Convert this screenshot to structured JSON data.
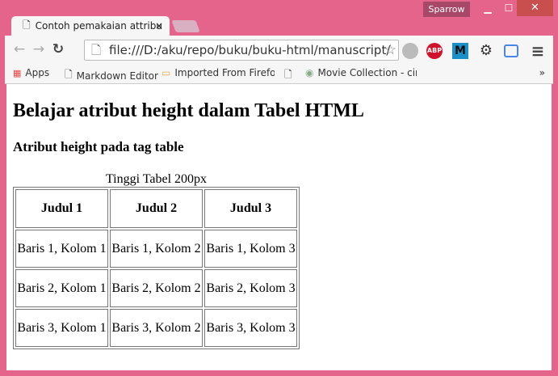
{
  "window": {
    "profile": "Sparrow",
    "minimize": "▁",
    "maximize": "☐",
    "close": "✕"
  },
  "tab": {
    "title": "Contoh pemakaian attribu",
    "close": "×"
  },
  "toolbar": {
    "back": "←",
    "forward": "→",
    "reload": "↻",
    "url": "file:///D:/aku/repo/buku/buku-html/manuscript/",
    "star": "☆",
    "abp": "ABP",
    "m": "M",
    "gear": "⚙",
    "menu": "≡"
  },
  "bookmarks": [
    {
      "label": "Apps"
    },
    {
      "label": "Markdown Editor"
    },
    {
      "label": "Imported From Firefox"
    },
    {
      "label": ""
    },
    {
      "label": "Movie Collection - cin"
    }
  ],
  "bookmarks_more": "»",
  "page": {
    "h1": "Belajar atribut height dalam Tabel HTML",
    "h3": "Atribut height pada tag table",
    "table": {
      "caption": "Tinggi Tabel 200px",
      "headers": [
        "Judul 1",
        "Judul 2",
        "Judul 3"
      ],
      "rows": [
        [
          "Baris 1, Kolom 1",
          "Baris 1, Kolom 2",
          "Baris 1, Kolom 3"
        ],
        [
          "Baris 2, Kolom 1",
          "Baris 2, Kolom 2",
          "Baris 2, Kolom 3"
        ],
        [
          "Baris 3, Kolom 1",
          "Baris 3, Kolom 2",
          "Baris 3, Kolom 3"
        ]
      ]
    }
  }
}
